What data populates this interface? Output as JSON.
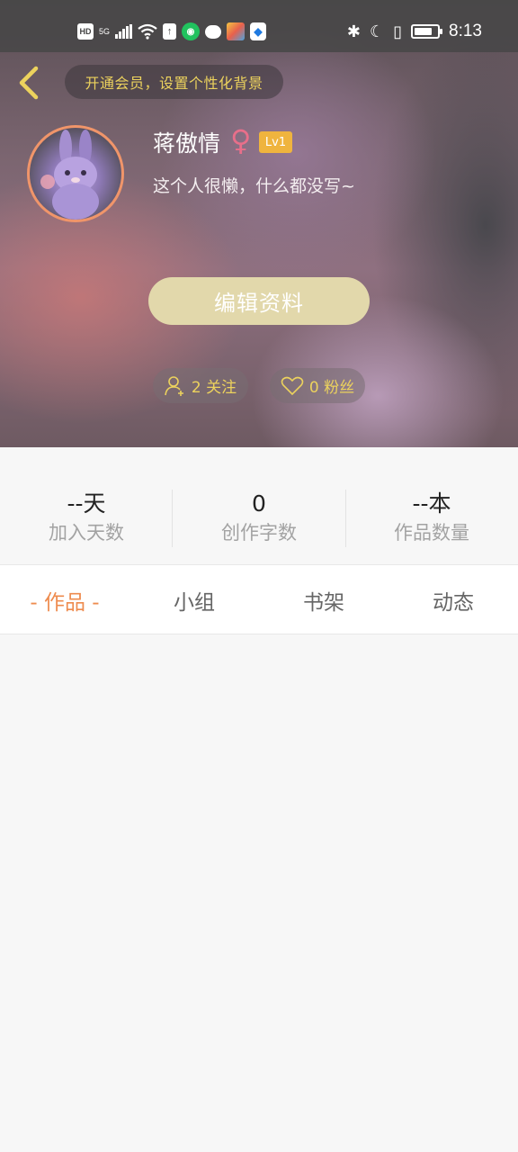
{
  "status_bar": {
    "left_icons": [
      "hd-icon",
      "5g-icon",
      "signal-icon",
      "wifi-icon",
      "upload-icon",
      "chat-app-icon",
      "message-icon",
      "app-icon",
      "shield-icon"
    ],
    "hd": "HD",
    "network": "5G",
    "time": "8:13",
    "battery_level": 0.8
  },
  "header": {
    "vip_banner": "开通会员，设置个性化背景"
  },
  "profile": {
    "name": "蒋傲情",
    "gender_symbol": "♀",
    "level": "Lv1",
    "bio": "这个人很懒，什么都没写~",
    "edit_button": "编辑资料",
    "follow": "2 关注",
    "fans": "0 粉丝"
  },
  "stats": [
    {
      "value": "--天",
      "label": "加入天数"
    },
    {
      "value": "0",
      "label": "创作字数"
    },
    {
      "value": "--本",
      "label": "作品数量"
    }
  ],
  "tabs": [
    {
      "label": "- 作品 -",
      "active": true
    },
    {
      "label": "小组",
      "active": false
    },
    {
      "label": "书架",
      "active": false
    },
    {
      "label": "动态",
      "active": false
    }
  ],
  "colors": {
    "accent": "#ee8b4e",
    "gold": "#ecd25d",
    "edit_button": "#e2d8ab",
    "level_badge": "#efb43e",
    "gender": "#e86f8a"
  }
}
